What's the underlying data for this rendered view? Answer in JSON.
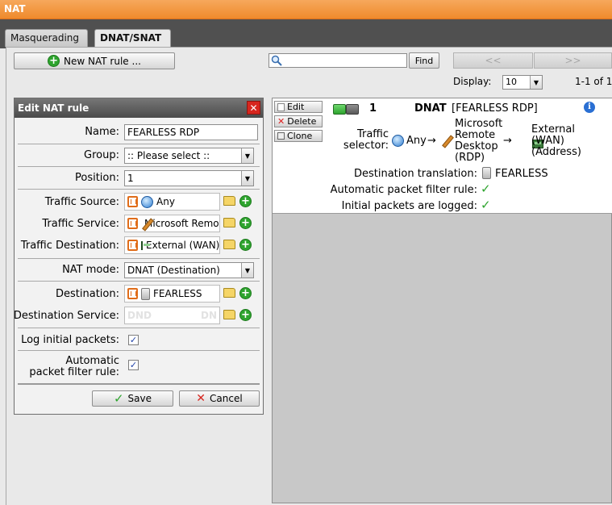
{
  "window": {
    "title": "NAT"
  },
  "tabs": [
    {
      "label": "Masquerading"
    },
    {
      "label": "DNAT/SNAT"
    }
  ],
  "toolbar": {
    "new_rule_label": "New NAT rule ...",
    "search_placeholder": "",
    "find_label": "Find",
    "prev_label": "<<",
    "next_label": ">>",
    "display_label": "Display:",
    "display_value": "10",
    "range_label": "1-1 of 1"
  },
  "dialog": {
    "title": "Edit NAT rule",
    "name_label": "Name:",
    "name_value": "FEARLESS RDP",
    "group_label": "Group:",
    "group_value": ":: Please select ::",
    "position_label": "Position:",
    "position_value": "1",
    "traffic_source_label": "Traffic Source:",
    "traffic_source_value": "Any",
    "traffic_service_label": "Traffic Service:",
    "traffic_service_value": "Microsoft Remote Desktop (RDP)",
    "traffic_destination_label": "Traffic Destination:",
    "traffic_destination_value": "External (WAN) (Address)",
    "nat_mode_label": "NAT mode:",
    "nat_mode_value": "DNAT (Destination)",
    "destination_label": "Destination:",
    "destination_value": "FEARLESS",
    "destination_service_label": "Destination Service:",
    "destination_service_placeholder": "DND",
    "destination_service_placeholder_2": "DN",
    "log_label": "Log initial packets:",
    "log_checked": true,
    "auto_filter_label_1": "Automatic",
    "auto_filter_label_2": "packet filter rule:",
    "auto_filter_checked": true,
    "check_glyph": "✓",
    "save_label": "Save",
    "cancel_label": "Cancel"
  },
  "rule": {
    "edit_label": "Edit",
    "delete_label": "Delete",
    "clone_label": "Clone",
    "number": "1",
    "type": "DNAT",
    "name": "[FEARLESS RDP]",
    "selector_label_1": "Traffic",
    "selector_label_2": "selector:",
    "source": "Any",
    "arrow": "→",
    "service_lines": [
      "Microsoft",
      "Remote",
      "Desktop",
      "(RDP)"
    ],
    "destination_lines": [
      "External",
      "(WAN)",
      "(Address)"
    ],
    "translation_label": "Destination translation:",
    "translation_value": "FEARLESS",
    "auto_filter_label": "Automatic packet filter rule:",
    "logged_label": "Initial packets are logged:",
    "check_glyph": "✓",
    "info_glyph": "i",
    "status": "enabled"
  },
  "colors": {
    "titlebar": "#ef8a2c",
    "accent_green": "#2ea42e",
    "danger_red": "#d7261e"
  }
}
